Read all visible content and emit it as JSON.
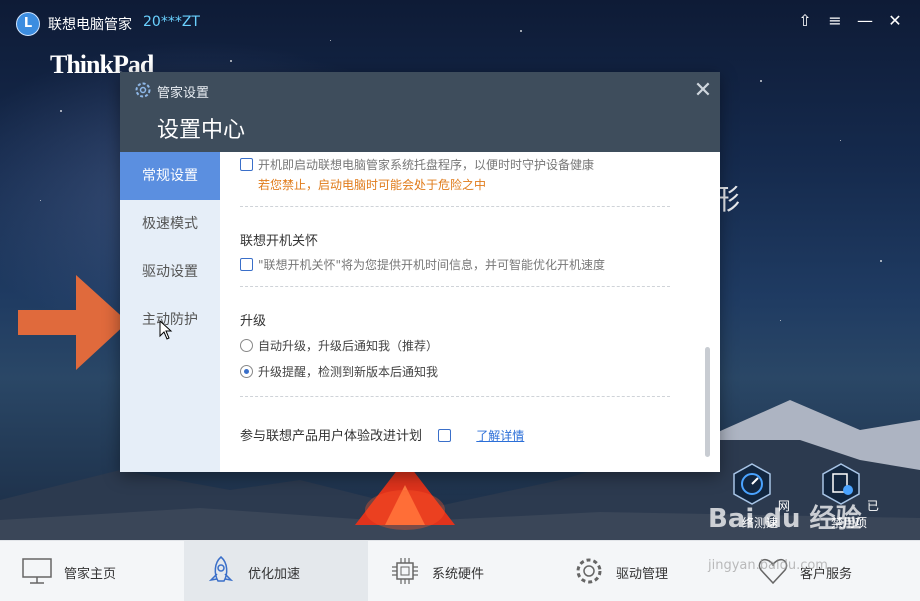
{
  "app": {
    "logo_letter": "L",
    "title": "联想电脑管家",
    "user": "20***ZT",
    "brand": "ThinkPad",
    "bg_char": "形"
  },
  "window_controls": [
    "⇧",
    "≡",
    "—",
    "✕"
  ],
  "dialog": {
    "tag": "管家设置",
    "title": "设置中心",
    "close": "✕",
    "sidebar": [
      {
        "label": "常规设置",
        "active": true
      },
      {
        "label": "极速模式",
        "active": false
      },
      {
        "label": "驱动设置",
        "active": false
      },
      {
        "label": "主动防护",
        "active": false
      }
    ],
    "content": {
      "tray_option": "开机即启动联想电脑管家系统托盘程序，以便时时守护设备健康",
      "tray_warning": "若您禁止，启动电脑时可能会处于危险之中",
      "boot_care_heading": "联想开机关怀",
      "boot_care_option": "\"联想开机关怀\"将为您提供开机时间信息，并可智能优化开机速度",
      "upgrade_heading": "升级",
      "upgrade_auto": "自动升级，升级后通知我（推荐）",
      "upgrade_notify": "升级提醒，检测到新版本后通知我",
      "experience_label": "参与联想产品用户体验改进计划",
      "learn_more": "了解详情"
    }
  },
  "float_buttons": [
    {
      "label": "网络测速",
      "icon": "speed-gauge-icon"
    },
    {
      "label": "已禁用项",
      "icon": "disabled-items-icon"
    }
  ],
  "bottom_tabs": [
    {
      "label": "管家主页",
      "icon": "monitor-icon",
      "active": false
    },
    {
      "label": "优化加速",
      "icon": "rocket-icon",
      "active": true
    },
    {
      "label": "系统硬件",
      "icon": "chip-icon",
      "active": false
    },
    {
      "label": "驱动管理",
      "icon": "gear-icon",
      "active": false
    },
    {
      "label": "客户服务",
      "icon": "heart-icon",
      "active": false
    }
  ],
  "watermark": {
    "main": "Bai du 经验",
    "sub": "jingyan.baidu.com"
  },
  "colors": {
    "accent": "#5b8fe0",
    "arrow": "#e06a3c",
    "warning": "#e07b1a",
    "link": "#2c6fd8"
  }
}
